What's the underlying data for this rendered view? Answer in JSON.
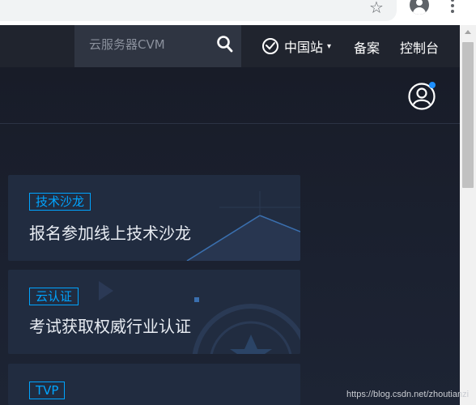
{
  "browser": {
    "star_icon": "star-outline-icon",
    "account_icon": "account-avatar-icon",
    "menu_icon": "vertical-dots-icon"
  },
  "header": {
    "search": {
      "placeholder": "云服务器CVM",
      "icon": "search-icon"
    },
    "region": {
      "label": "中国站",
      "icon": "region-globe-icon"
    },
    "links": [
      "备案",
      "控制台"
    ]
  },
  "user": {
    "icon": "user-circle-icon",
    "notification_color": "#1e90ff"
  },
  "cards": [
    {
      "tag": "技术沙龙",
      "title": "报名参加线上技术沙龙"
    },
    {
      "tag": "云认证",
      "title": "考试获取权威行业认证"
    },
    {
      "tag": "TVP",
      "title": ""
    }
  ],
  "watermark": "https://blog.csdn.net/zhoutianzi",
  "colors": {
    "accent": "#00a4ff",
    "card_bg": "#212c40",
    "header_bg": "#20242e"
  }
}
